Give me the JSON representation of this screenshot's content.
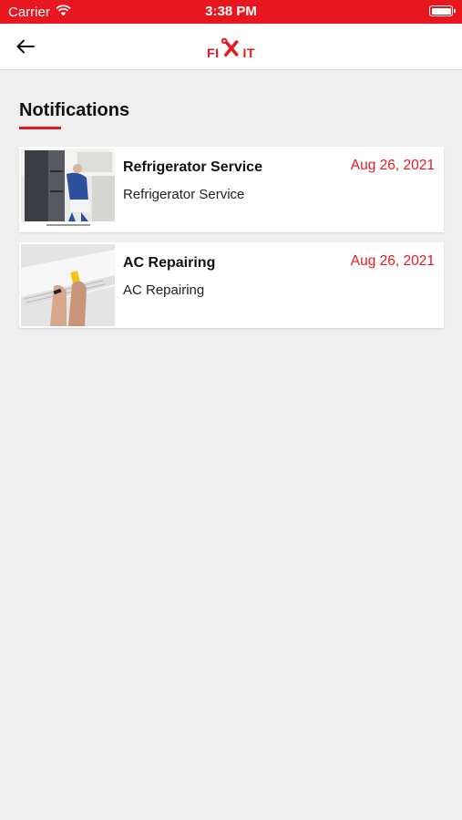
{
  "status_bar": {
    "carrier": "Carrier",
    "time": "3:38 PM"
  },
  "nav": {
    "logo_left": "FI",
    "logo_right": "IT"
  },
  "page_title": "Notifications",
  "notifications": [
    {
      "title": "Refrigerator Service",
      "subtitle": "Refrigerator Service",
      "date": "Aug 26, 2021"
    },
    {
      "title": "AC Repairing",
      "subtitle": "AC Repairing",
      "date": "Aug 26, 2021"
    }
  ],
  "colors": {
    "accent": "#e8161f",
    "background": "#efefef"
  }
}
